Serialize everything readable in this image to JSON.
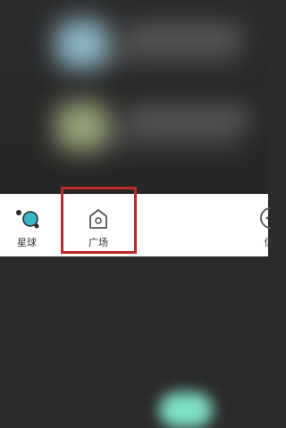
{
  "tabbar": {
    "tabs": [
      {
        "label": "星球",
        "icon": "planet-icon"
      },
      {
        "label": "广场",
        "icon": "home-icon"
      },
      {
        "label": "",
        "icon": "blurred-tab-icon"
      },
      {
        "label": "信",
        "icon": "message-icon"
      }
    ]
  },
  "colors": {
    "highlight": "#c0282d",
    "accent": "#3bb6c4",
    "background": "#2a2a2a",
    "tabbar": "#ffffff"
  }
}
